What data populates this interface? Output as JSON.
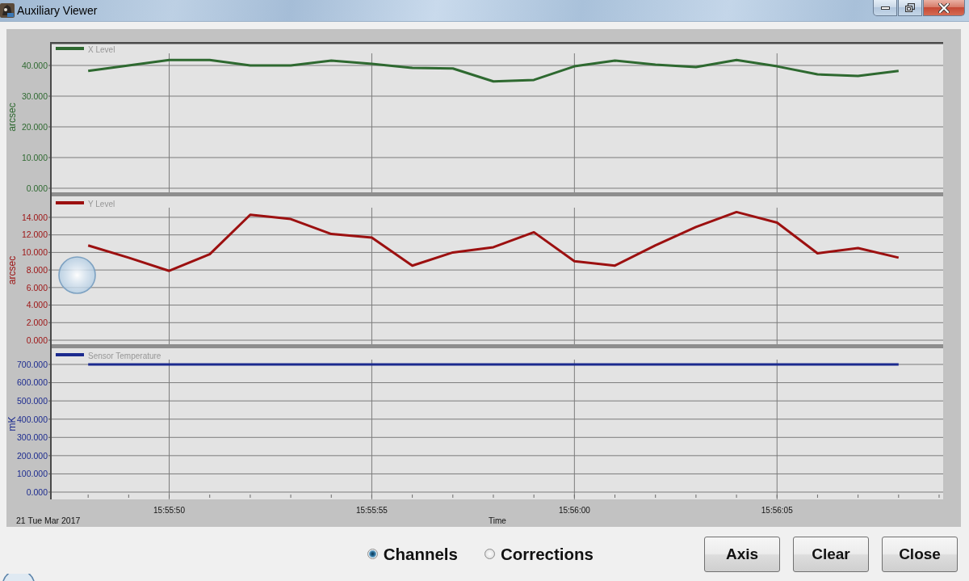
{
  "window": {
    "title": "Auxiliary Viewer"
  },
  "plots": [
    {
      "chart_data": {
        "type": "line",
        "ylabel": "arcsec",
        "grid": true,
        "series": [
          {
            "name": "X Level",
            "color": "#2e6930",
            "values": [
              38.2,
              40.0,
              41.8,
              41.8,
              40.0,
              40.0,
              41.6,
              40.5,
              39.2,
              39.0,
              34.8,
              35.3,
              39.7,
              41.6,
              40.3,
              39.5,
              41.8,
              39.7,
              37.1,
              36.6,
              38.2
            ]
          }
        ],
        "ylim": [
          -1.32,
          47.63
        ],
        "yticks": [
          {
            "value": 0,
            "label": "0.000"
          },
          {
            "value": 10,
            "label": "10.000"
          },
          {
            "value": 20,
            "label": "20.000"
          },
          {
            "value": 30,
            "label": "30.000"
          },
          {
            "value": 40,
            "label": "40.000"
          }
        ]
      }
    },
    {
      "chart_data": {
        "type": "line",
        "ylabel": "arcsec",
        "grid": true,
        "series": [
          {
            "name": "Y Level",
            "color": "#9c1010",
            "values": [
              10.8,
              9.4,
              7.9,
              9.8,
              14.3,
              13.8,
              12.1,
              11.7,
              8.5,
              10.0,
              10.6,
              12.3,
              9.0,
              8.5,
              10.8,
              12.9,
              14.6,
              13.4,
              9.9,
              10.5,
              9.4
            ]
          }
        ],
        "ylim": [
          -0.46,
          16.39
        ],
        "yticks": [
          {
            "value": 0,
            "label": "0.000"
          },
          {
            "value": 2,
            "label": "2.000"
          },
          {
            "value": 4,
            "label": "4.000"
          },
          {
            "value": 6,
            "label": "6.000"
          },
          {
            "value": 8,
            "label": "8.000"
          },
          {
            "value": 10,
            "label": "10.000"
          },
          {
            "value": 12,
            "label": "12.000"
          },
          {
            "value": 14,
            "label": "14.000"
          }
        ]
      }
    },
    {
      "chart_data": {
        "type": "line",
        "xlabel": "Time",
        "ylabel": "mK",
        "grid": true,
        "categories": [
          null,
          null,
          "15:55:50",
          null,
          null,
          null,
          null,
          "15:55:55",
          null,
          null,
          null,
          null,
          "15:56:00",
          null,
          null,
          null,
          null,
          "15:56:05",
          null,
          null,
          null
        ],
        "series": [
          {
            "name": "Sensor Temperature",
            "color": "#1b2a8e",
            "values": [
              700,
              700,
              700,
              700,
              700,
              700,
              700,
              700,
              700,
              700,
              700,
              700,
              700,
              700,
              700,
              700,
              700,
              700,
              700,
              700,
              700
            ]
          }
        ],
        "ylim": [
          -39.9,
          788.6
        ],
        "yticks": [
          {
            "value": 0,
            "label": "0.000"
          },
          {
            "value": 100,
            "label": "100.000"
          },
          {
            "value": 200,
            "label": "200.000"
          },
          {
            "value": 300,
            "label": "300.000"
          },
          {
            "value": 400,
            "label": "400.000"
          },
          {
            "value": 500,
            "label": "500.000"
          },
          {
            "value": 600,
            "label": "600.000"
          },
          {
            "value": 700,
            "label": "700.000"
          }
        ]
      }
    }
  ],
  "date": "21 Tue Mar 2017",
  "view_options": [
    {
      "label": "Channels",
      "selected": true
    },
    {
      "label": "Corrections",
      "selected": false
    }
  ],
  "buttons": [
    {
      "label": "Axis"
    },
    {
      "label": "Clear"
    },
    {
      "label": "Close"
    }
  ]
}
